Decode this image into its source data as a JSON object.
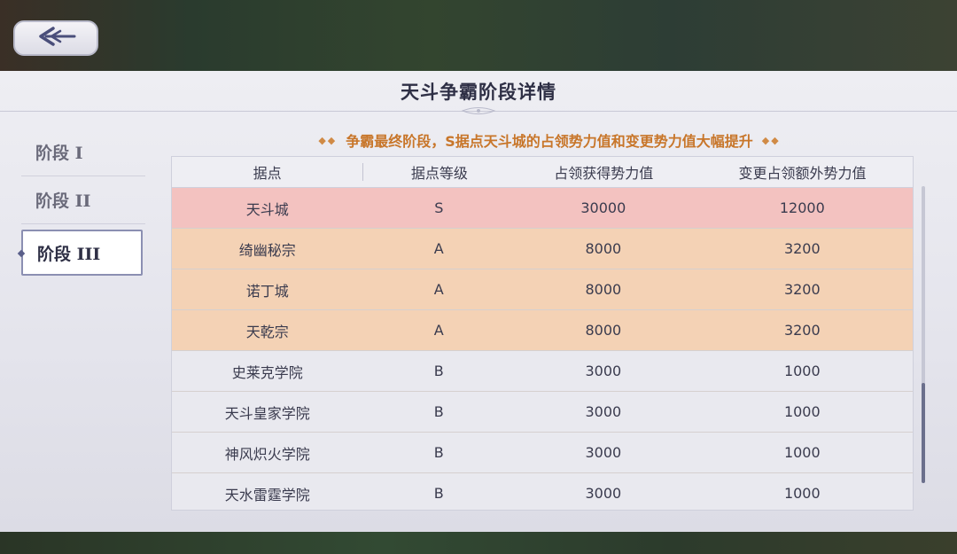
{
  "panel": {
    "title": "天斗争霸阶段详情"
  },
  "stages": [
    {
      "label": "阶段 I"
    },
    {
      "label": "阶段 II"
    },
    {
      "label": "阶段 III"
    }
  ],
  "notice": {
    "text": "争霸最终阶段，S据点天斗城的占领势力值和变更势力值大幅提升",
    "deco_left": "◆◆",
    "deco_right": "◆◆"
  },
  "table": {
    "headers": [
      "据点",
      "据点等级",
      "占领获得势力值",
      "变更占领额外势力值"
    ],
    "rows": [
      {
        "name": "天斗城",
        "level": "S",
        "occupy": "30000",
        "change": "12000",
        "tier_color": "#f3c2c0"
      },
      {
        "name": "绮幽秘宗",
        "level": "A",
        "occupy": "8000",
        "change": "3200",
        "tier_color": "#f4d2b5"
      },
      {
        "name": "诺丁城",
        "level": "A",
        "occupy": "8000",
        "change": "3200",
        "tier_color": "#f4d2b5"
      },
      {
        "name": "天乾宗",
        "level": "A",
        "occupy": "8000",
        "change": "3200",
        "tier_color": "#f4d2b5"
      },
      {
        "name": "史莱克学院",
        "level": "B",
        "occupy": "3000",
        "change": "1000",
        "tier_color": "#e9e9ef"
      },
      {
        "name": "天斗皇家学院",
        "level": "B",
        "occupy": "3000",
        "change": "1000",
        "tier_color": "#e9e9ef"
      },
      {
        "name": "神风炽火学院",
        "level": "B",
        "occupy": "3000",
        "change": "1000",
        "tier_color": "#e9e9ef"
      },
      {
        "name": "天水雷霆学院",
        "level": "B",
        "occupy": "3000",
        "change": "1000",
        "tier_color": "#e9e9ef"
      }
    ]
  },
  "colors": {
    "accent_text": "#c8762a",
    "title_text": "#2e2f45",
    "tier_s": "#f3c2c0",
    "tier_a": "#f4d2b5",
    "tier_b": "#e9e9ef"
  },
  "icons": {
    "back": "back-arrow-icon"
  }
}
